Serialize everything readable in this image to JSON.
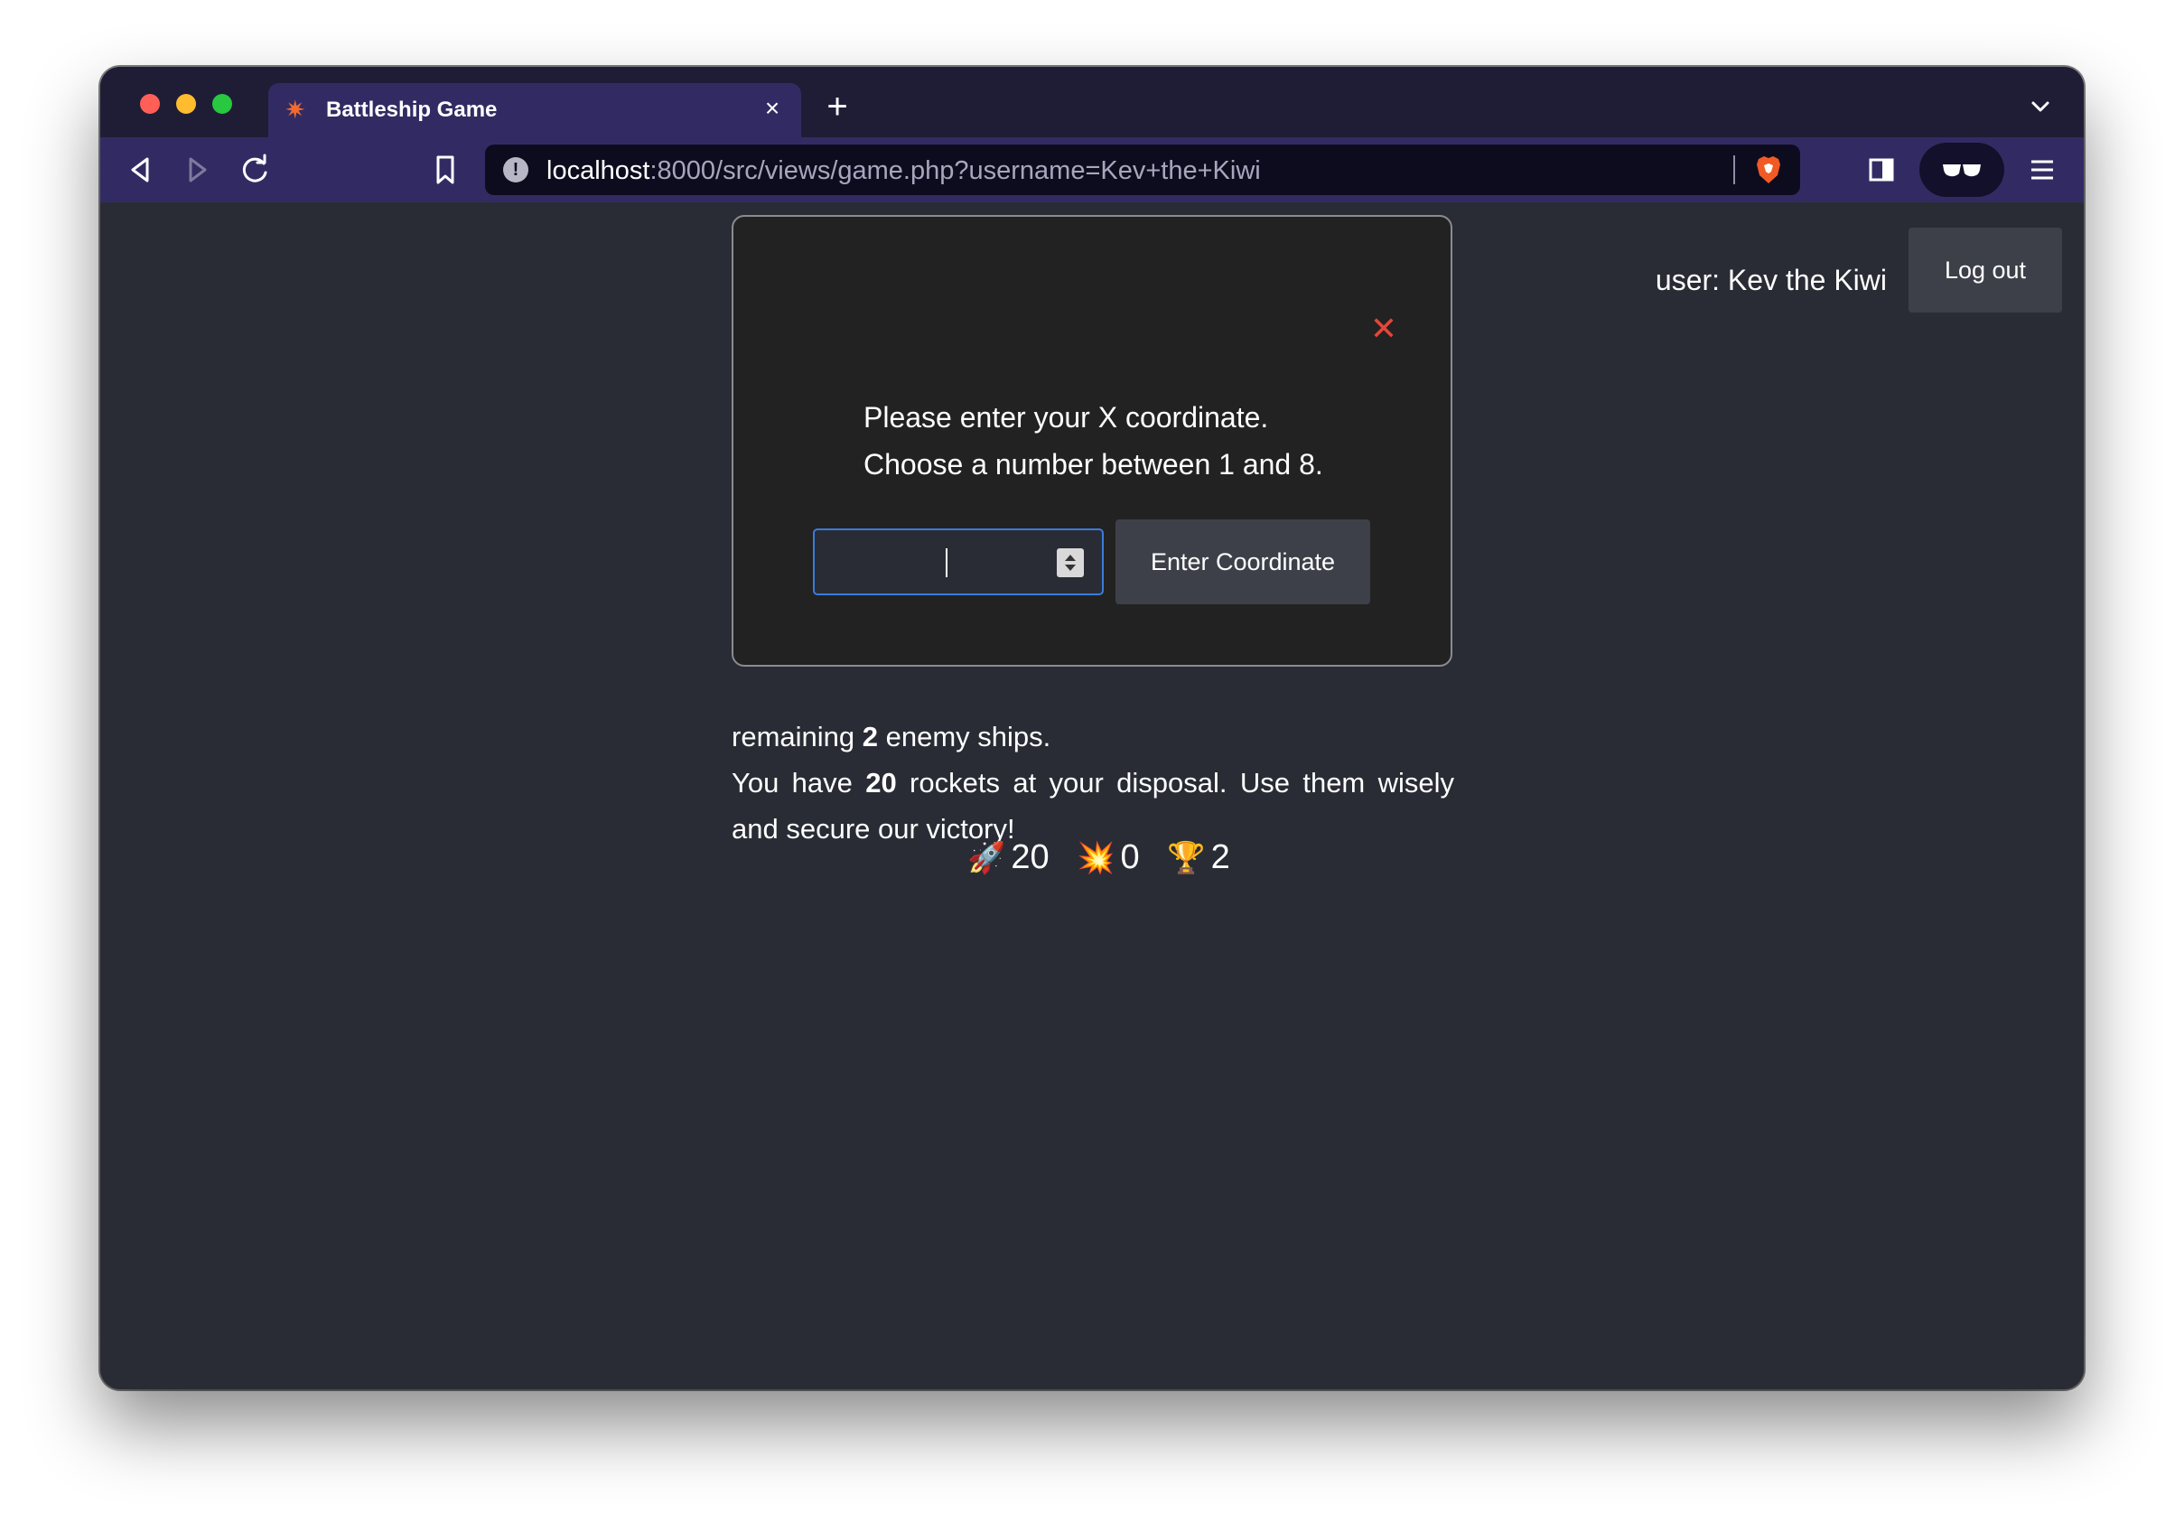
{
  "browser": {
    "tab": {
      "title": "Battleship Game",
      "favicon": "explosion-icon",
      "close_label": "×"
    },
    "new_tab_label": "+",
    "url": {
      "host": "localhost",
      "rest": ":8000/src/views/game.php?username=Kev+the+Kiwi"
    },
    "info_glyph": "!"
  },
  "header": {
    "user_label": "user: Kev the Kiwi",
    "logout_label": "Log out"
  },
  "story": {
    "line1_prefix": "remaining ",
    "line1_count": "2",
    "line1_suffix": " enemy ships.",
    "line2_prefix": "You have ",
    "line2_count": "20",
    "line2_suffix": " rockets at your disposal. Use them wisely and secure our victory!"
  },
  "stats": {
    "rockets_icon": "🚀",
    "rockets": "20",
    "hits_icon": "💥",
    "hits": "0",
    "ships_icon": "🏆",
    "ships": "2"
  },
  "modal": {
    "close_label": "✕",
    "prompt_line1": "Please enter your X coordinate.",
    "prompt_line2": "Choose a number between 1 and 8.",
    "input_value": "",
    "submit_label": "Enter Coordinate"
  },
  "colors": {
    "tabbar": "#1f1d36",
    "toolbar": "#322b63",
    "page_bg": "#292c34",
    "modal_bg": "#222222",
    "close_red": "#e4463a",
    "button_bg": "#3d4049",
    "input_focus": "#3a7bdc"
  }
}
